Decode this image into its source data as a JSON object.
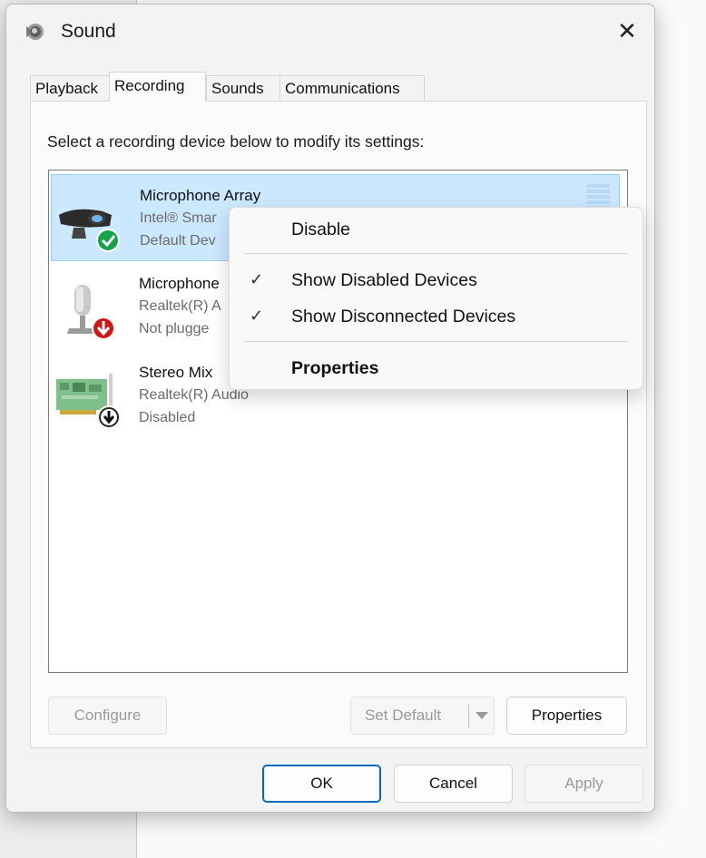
{
  "window": {
    "title": "Sound",
    "close_glyph": "✕"
  },
  "tabs": [
    {
      "label": "Playback",
      "active": false
    },
    {
      "label": "Recording",
      "active": true
    },
    {
      "label": "Sounds",
      "active": false
    },
    {
      "label": "Communications",
      "active": false
    }
  ],
  "instruction": "Select a recording device below to modify its settings:",
  "devices": [
    {
      "name": "Microphone Array",
      "description": "Intel® Smar",
      "status": "Default Dev",
      "icon": "webcam-microphone-icon",
      "badge": "default-check-badge-icon",
      "selected": true
    },
    {
      "name": "Microphone",
      "description": "Realtek(R) A",
      "status": "Not plugge",
      "icon": "microphone-icon",
      "badge": "unplugged-arrow-badge-icon",
      "selected": false
    },
    {
      "name": "Stereo Mix",
      "description": "Realtek(R) Audio",
      "status": "Disabled",
      "icon": "sound-card-icon",
      "badge": "disabled-arrow-badge-icon",
      "selected": false
    }
  ],
  "buttons": {
    "configure": "Configure",
    "set_default": "Set Default",
    "properties": "Properties",
    "ok": "OK",
    "cancel": "Cancel",
    "apply": "Apply"
  },
  "context_menu": {
    "items": [
      {
        "label": "Disable",
        "checked": false,
        "bold": false
      },
      {
        "label": "Show Disabled Devices",
        "checked": true,
        "bold": false
      },
      {
        "label": "Show Disconnected Devices",
        "checked": true,
        "bold": false
      },
      {
        "label": "Properties",
        "checked": false,
        "bold": true
      }
    ],
    "check_glyph": "✓"
  },
  "colors": {
    "selection_bg": "#cce8ff",
    "selection_border": "#99d1ff",
    "accent": "#0067c0",
    "check_badge": "#16a34a",
    "unplugged_badge": "#d11616"
  }
}
